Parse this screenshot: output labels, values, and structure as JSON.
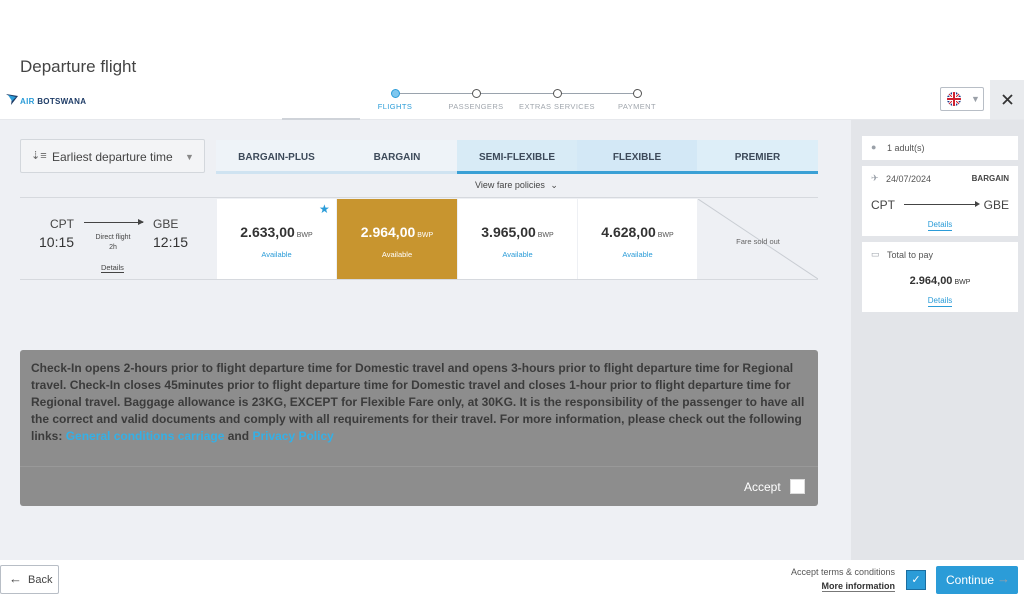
{
  "page": {
    "title": "Departure flight"
  },
  "brand": {
    "name_prefix": "AIR",
    "name_main": "BOTSWANA",
    "accent": "#2b9cd8",
    "selected_fare_color": "#c8952f"
  },
  "steps": [
    {
      "label": "FLIGHTS",
      "active": true
    },
    {
      "label": "PASSENGERS",
      "active": false
    },
    {
      "label": "EXTRAS SERVICES",
      "active": false
    },
    {
      "label": "PAYMENT",
      "active": false
    }
  ],
  "language": {
    "flag": "uk-flag-icon"
  },
  "sort": {
    "label": "Earliest departure time"
  },
  "fare_families": [
    {
      "label": "BARGAIN-PLUS"
    },
    {
      "label": "BARGAIN"
    },
    {
      "label": "SEMI-FLEXIBLE"
    },
    {
      "label": "FLEXIBLE"
    },
    {
      "label": "PREMIER"
    }
  ],
  "view_fare_policies": "View fare policies",
  "flight": {
    "origin": "CPT",
    "destination": "GBE",
    "departure_time": "10:15",
    "arrival_time": "12:15",
    "direct": "Direct flight",
    "duration": "2h",
    "details": "Details"
  },
  "fares": [
    {
      "price": "2.633,00",
      "currency": "BWP",
      "status": "Available"
    },
    {
      "price": "2.964,00",
      "currency": "BWP",
      "status": "Available"
    },
    {
      "price": "3.965,00",
      "currency": "BWP",
      "status": "Available"
    },
    {
      "price": "4.628,00",
      "currency": "BWP",
      "status": "Available"
    }
  ],
  "sold_out": "Fare sold out",
  "notice": {
    "text": "Check-In opens 2-hours prior to flight departure time for Domestic travel and opens 3-hours prior to flight departure time for Regional travel. Check-In closes 45minutes prior to flight departure time for Domestic travel and closes 1-hour prior to flight departure time for Regional travel. Baggage allowance is 23KG, EXCEPT for Flexible Fare only, at 30KG. It is the responsibility of the passenger to have all the correct and valid documents and comply with all requirements for their travel. For more information, please check out the following links:",
    "link1": "General conditions carriage",
    "and": "and",
    "link2": "Privacy Policy",
    "accept": "Accept"
  },
  "summary": {
    "passengers": "1 adult(s)",
    "date": "24/07/2024",
    "fare": "BARGAIN",
    "origin": "CPT",
    "destination": "GBE",
    "details": "Details",
    "total_label": "Total to pay",
    "total": "2.964,00",
    "currency": "BWP",
    "total_details": "Details"
  },
  "footer": {
    "back": "Back",
    "terms": "Accept terms & conditions",
    "more_info": "More information",
    "continue": "Continue"
  }
}
